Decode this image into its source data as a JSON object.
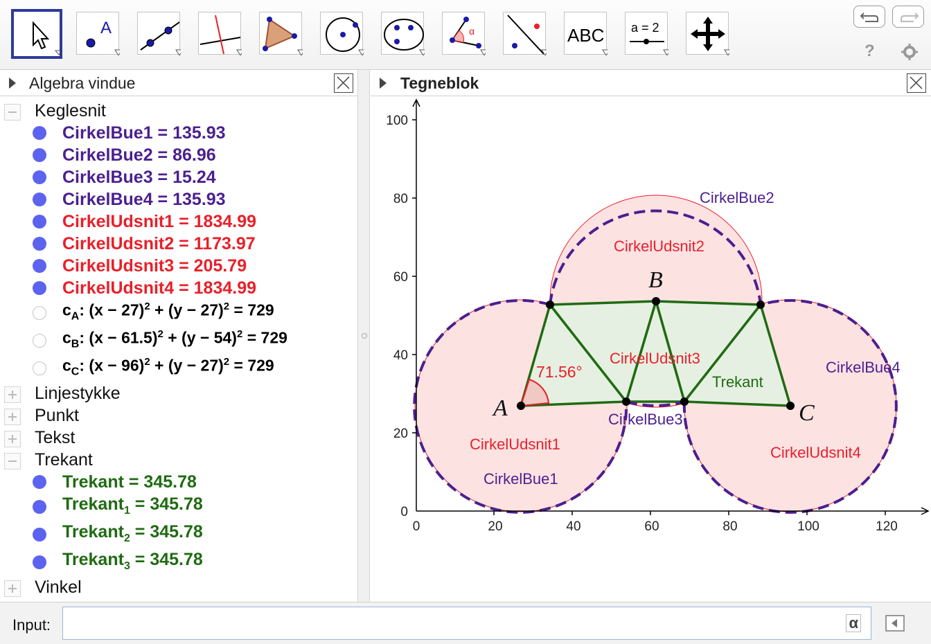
{
  "toolbar": {
    "tools": [
      {
        "name": "move-tool"
      },
      {
        "name": "point-tool"
      },
      {
        "name": "line-tool"
      },
      {
        "name": "perpendicular-line-tool"
      },
      {
        "name": "polygon-tool"
      },
      {
        "name": "circle-tool"
      },
      {
        "name": "conic-tool"
      },
      {
        "name": "angle-tool"
      },
      {
        "name": "reflect-tool"
      },
      {
        "name": "text-tool",
        "label": "ABC"
      },
      {
        "name": "slider-tool",
        "label": "a = 2"
      },
      {
        "name": "move-graphics-view-tool"
      }
    ],
    "help_label": "?"
  },
  "algebra": {
    "title": "Algebra vindue",
    "cat_keglesnit": "Keglesnit",
    "items_keglesnit": [
      {
        "text": "CirkelBue1 = 135.93",
        "color": "#4b1f8f"
      },
      {
        "text": "CirkelBue2 = 86.96",
        "color": "#4b1f8f"
      },
      {
        "text": "CirkelBue3 = 15.24",
        "color": "#4b1f8f"
      },
      {
        "text": "CirkelBue4 = 135.93",
        "color": "#4b1f8f"
      },
      {
        "text": "CirkelUdsnit1 = 1834.99",
        "color": "#e8202a"
      },
      {
        "text": "CirkelUdsnit2 = 1173.97",
        "color": "#e8202a"
      },
      {
        "text": "CirkelUdsnit3 = 205.79",
        "color": "#e8202a"
      },
      {
        "text": "CirkelUdsnit4 = 1834.99",
        "color": "#e8202a"
      }
    ],
    "circles": [
      {
        "c": "c",
        "sub": "A",
        "a": ": (x − 27)",
        "b": " + (y − 27)",
        "e": " = 729"
      },
      {
        "c": "c",
        "sub": "B",
        "a": ": (x − 61.5)",
        "b": " + (y − 54)",
        "e": " = 729"
      },
      {
        "c": "c",
        "sub": "C",
        "a": ": (x − 96)",
        "b": " + (y − 27)",
        "e": " = 729"
      }
    ],
    "sq": "2",
    "cat_linjestykke": "Linjestykke",
    "cat_punkt": "Punkt",
    "cat_tekst": "Tekst",
    "cat_trekant": "Trekant",
    "trekant_items": [
      {
        "name": "Trekant",
        "sub": "",
        "val": " = 345.78"
      },
      {
        "name": "Trekant",
        "sub": "1",
        "val": " = 345.78"
      },
      {
        "name": "Trekant",
        "sub": "2",
        "val": " = 345.78"
      },
      {
        "name": "Trekant",
        "sub": "3",
        "val": " = 345.78"
      }
    ],
    "trekant_color": "#1f6b12",
    "cat_vinkel": "Vinkel"
  },
  "graphics": {
    "title": "Tegneblok",
    "labels": {
      "A": "A",
      "B": "B",
      "C": "C",
      "CirkelBue1": "CirkelBue1",
      "CirkelBue2": "CirkelBue2",
      "CirkelBue3": "CirkelBue3",
      "CirkelBue4": "CirkelBue4",
      "CirkelUdsnit1": "CirkelUdsnit1",
      "CirkelUdsnit2": "CirkelUdsnit2",
      "CirkelUdsnit3": "CirkelUdsnit3",
      "CirkelUdsnit4": "CirkelUdsnit4",
      "Trekant": "Trekant",
      "angle": "71.56°"
    },
    "x_ticks": [
      "0",
      "20",
      "40",
      "60",
      "80",
      "100",
      "120"
    ],
    "y_ticks": [
      "0",
      "20",
      "40",
      "60",
      "80",
      "100"
    ],
    "colors": {
      "arc": "#4b1f8f",
      "sector": "#e8202a",
      "triangle": "#1f6b12"
    }
  },
  "input": {
    "label": "Input:",
    "value": "",
    "alpha": "α"
  }
}
